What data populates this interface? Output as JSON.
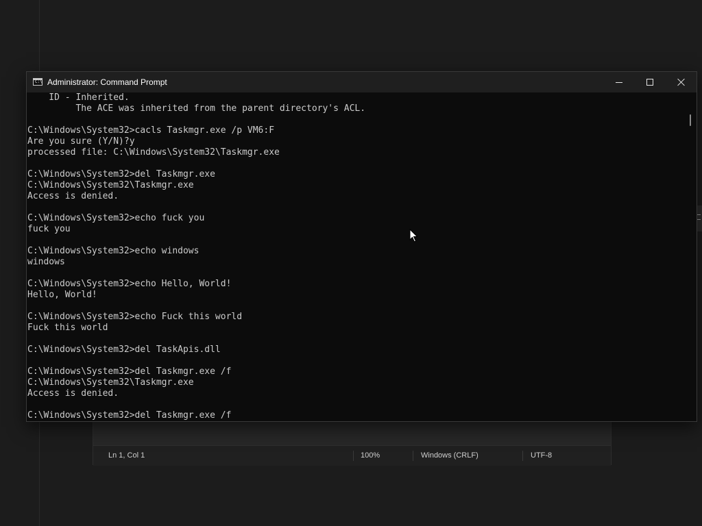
{
  "cmd_window": {
    "title": "Administrator: Command Prompt",
    "icon": "cmd-icon",
    "icon_glyph": "C:\\",
    "controls": {
      "minimize": "minimize-icon",
      "maximize": "maximize-icon",
      "close": "close-icon"
    },
    "lines": [
      "    ID - Inherited.",
      "         The ACE was inherited from the parent directory's ACL.",
      "",
      "C:\\Windows\\System32>cacls Taskmgr.exe /p VM6:F",
      "Are you sure (Y/N)?y",
      "processed file: C:\\Windows\\System32\\Taskmgr.exe",
      "",
      "C:\\Windows\\System32>del Taskmgr.exe",
      "C:\\Windows\\System32\\Taskmgr.exe",
      "Access is denied.",
      "",
      "C:\\Windows\\System32>echo fuck you",
      "fuck you",
      "",
      "C:\\Windows\\System32>echo windows",
      "windows",
      "",
      "C:\\Windows\\System32>echo Hello, World!",
      "Hello, World!",
      "",
      "C:\\Windows\\System32>echo Fuck this world",
      "Fuck this world",
      "",
      "C:\\Windows\\System32>del TaskApis.dll",
      "",
      "C:\\Windows\\System32>del Taskmgr.exe /f",
      "C:\\Windows\\System32\\Taskmgr.exe",
      "Access is denied.",
      "",
      "C:\\Windows\\System32>del Taskmgr.exe /f"
    ]
  },
  "notepad_statusbar": {
    "position": "Ln 1, Col 1",
    "zoom": "100%",
    "line_ending": "Windows (CRLF)",
    "encoding": "UTF-8"
  },
  "colors": {
    "console_bg": "#0c0c0c",
    "console_fg": "#cccccc",
    "titlebar_bg": "#1f1f1f"
  }
}
